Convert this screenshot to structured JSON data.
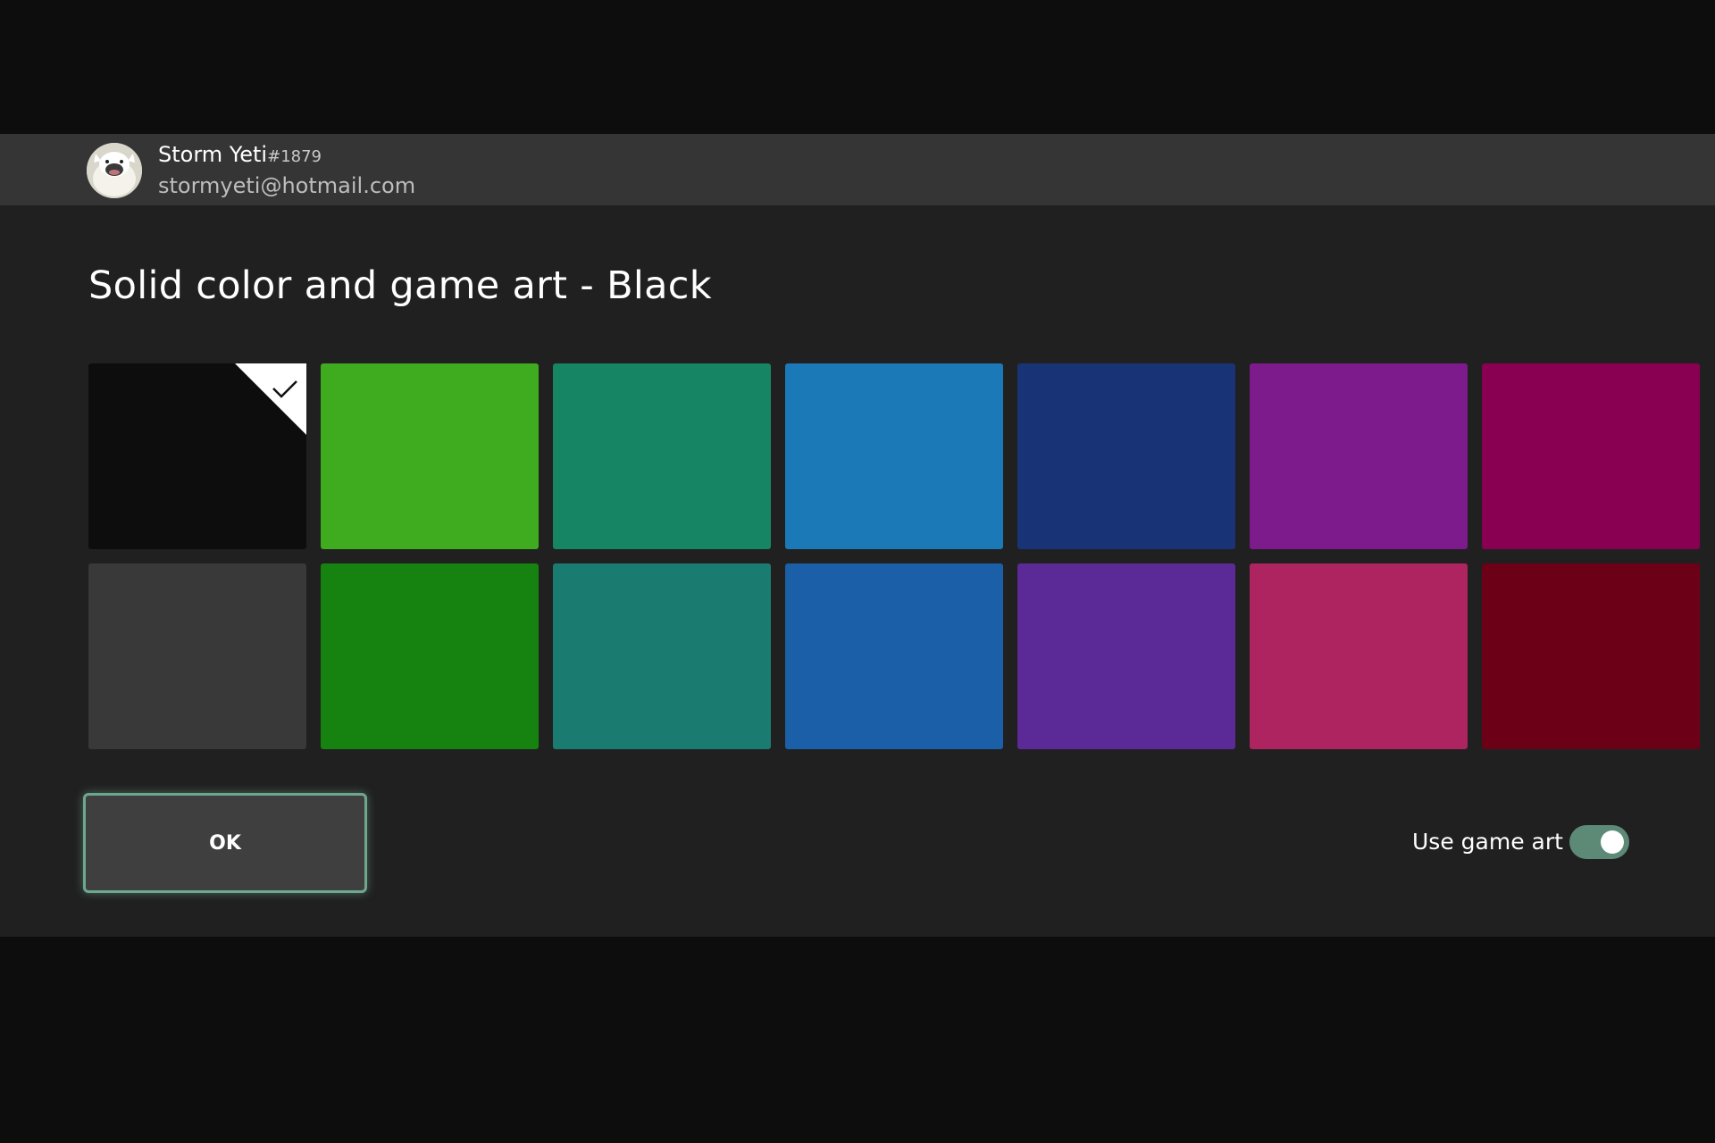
{
  "header": {
    "gamertag": "Storm Yeti",
    "gamertag_suffix": "#1879",
    "email": "stormyeti@hotmail.com",
    "avatar_icon": "yeti-avatar-icon"
  },
  "title": "Solid color and game art - Black",
  "swatches": {
    "selected": "black",
    "colors": [
      "#0d0d0d",
      "#3fab1f",
      "#168564",
      "#1c79b8",
      "#183477",
      "#7e1b8c",
      "#890052",
      "#393939",
      "#168310",
      "#1a7c70",
      "#1a5fa8",
      "#5c2a96",
      "#ae2460",
      "#6b0017"
    ]
  },
  "ok_button": {
    "label": "OK"
  },
  "use_game_art": {
    "label": "Use game art",
    "on": true
  }
}
